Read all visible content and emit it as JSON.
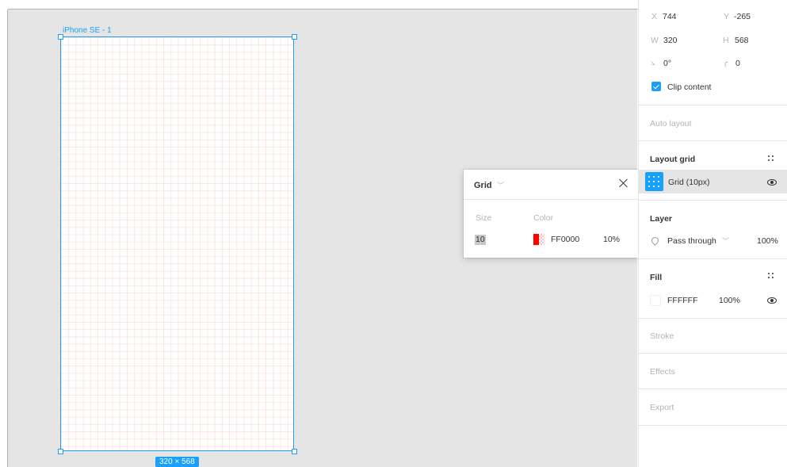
{
  "canvas": {
    "frame_label": "iPhone SE - 1",
    "size_badge": "320 × 568"
  },
  "grid_popover": {
    "title": "Grid",
    "size_label": "Size",
    "color_label": "Color",
    "size_value": "10",
    "color_hex": "FF0000",
    "opacity": "10%",
    "colors": {
      "grid": "#ff0000"
    }
  },
  "panel": {
    "x_label": "X",
    "x_value": "744",
    "y_label": "Y",
    "y_value": "-265",
    "w_label": "W",
    "w_value": "320",
    "h_label": "H",
    "h_value": "568",
    "rotation_value": "0°",
    "radius_value": "0",
    "clip_content_label": "Clip content",
    "clip_content_checked": true,
    "auto_layout_title": "Auto layout",
    "layout_grid_title": "Layout grid",
    "layout_grid_item": "Grid (10px)",
    "layer_title": "Layer",
    "blend_mode": "Pass through",
    "layer_opacity": "100%",
    "fill_title": "Fill",
    "fill_hex": "FFFFFF",
    "fill_opacity": "100%",
    "stroke_title": "Stroke",
    "effects_title": "Effects",
    "export_title": "Export"
  },
  "colors": {
    "accent": "#18a0fb",
    "canvas": "#e5e5e5"
  }
}
